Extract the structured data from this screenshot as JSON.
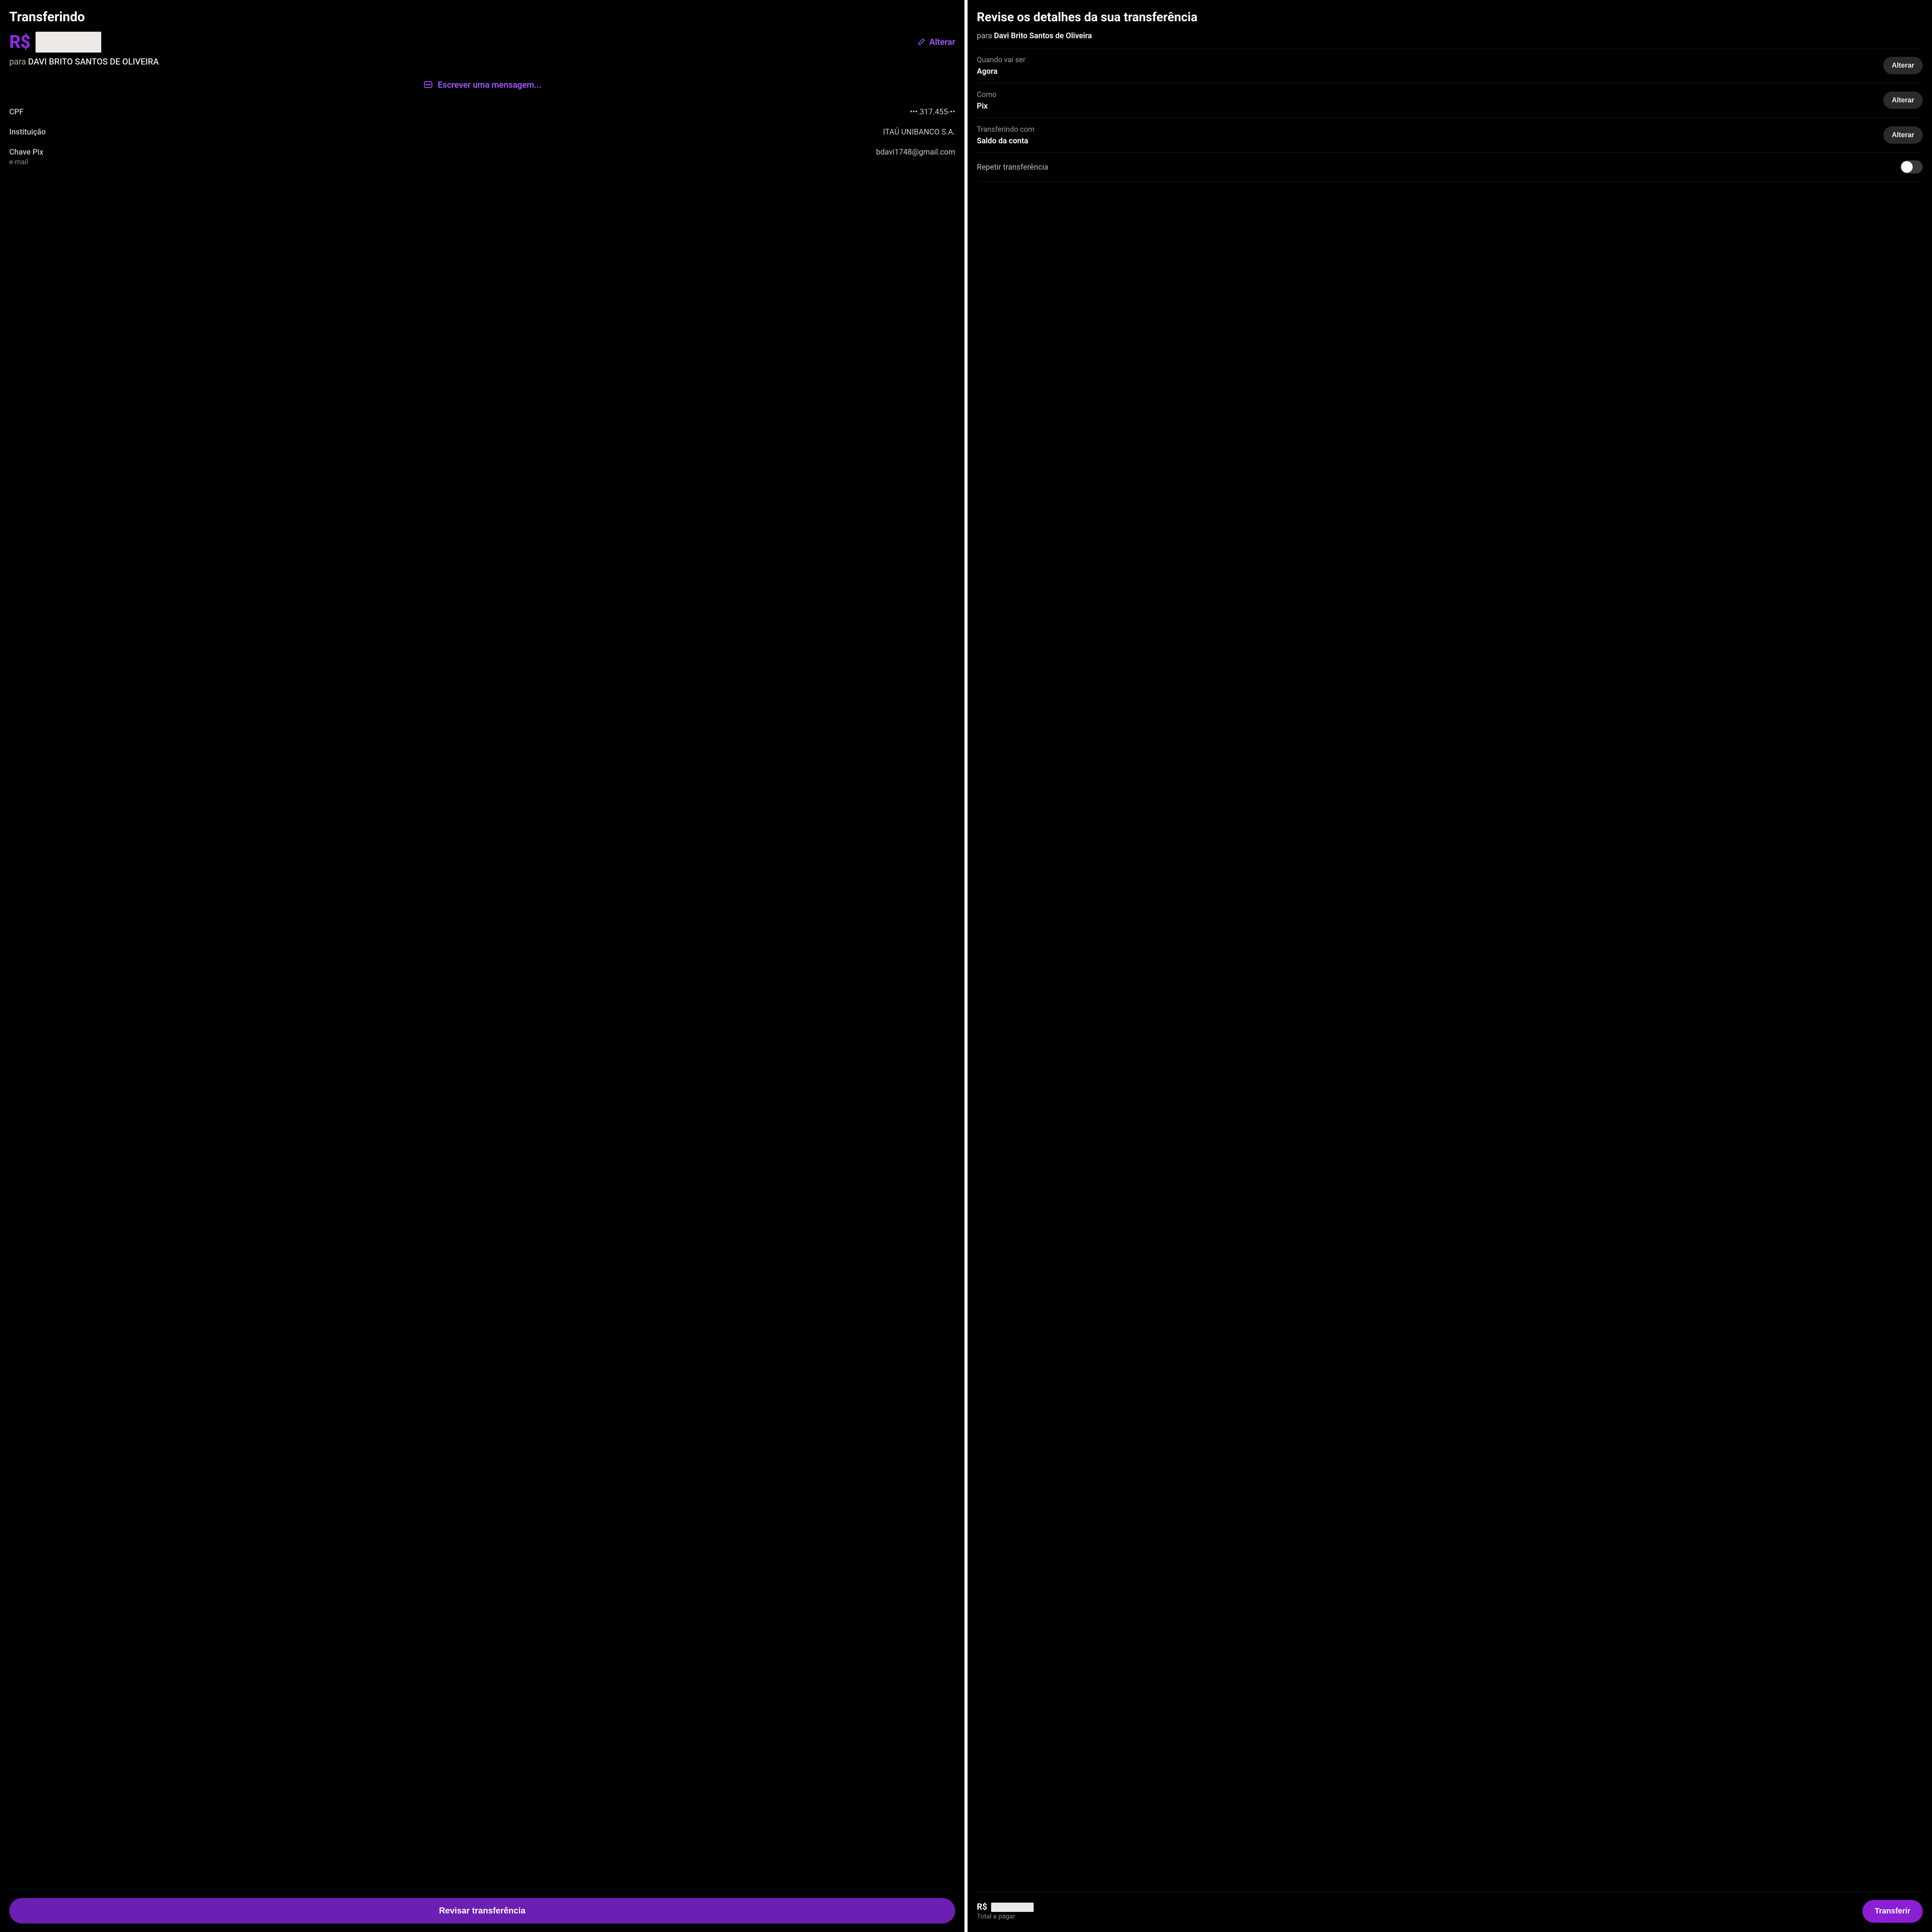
{
  "colors": {
    "accent": "#a259ff",
    "primary_button": "#6b1fb3",
    "transfer_button": "#8a1fd6"
  },
  "left": {
    "title": "Transferindo",
    "currency": "R$",
    "edit_label": "Alterar",
    "recipient_prefix": "para",
    "recipient_name": "DAVI BRITO SANTOS DE OLIVEIRA",
    "write_message": "Escrever uma mensagem...",
    "info": [
      {
        "label": "CPF",
        "sublabel": "",
        "value": "•••.317.455-••"
      },
      {
        "label": "Instituição",
        "sublabel": "",
        "value": "ITAÚ UNIBANCO S.A."
      },
      {
        "label": "Chave Pix",
        "sublabel": "e-mail",
        "value": "bdavi1748@gmail.com"
      }
    ],
    "primary_button": "Revisar transferência"
  },
  "right": {
    "title": "Revise os detalhes da sua transferência",
    "recipient_prefix": "para",
    "recipient_name": "Davi Brito Santos de Oliveira",
    "details": [
      {
        "label": "Quando vai ser",
        "value": "Agora",
        "action": "Alterar"
      },
      {
        "label": "Como",
        "value": "Pix",
        "action": "Alterar"
      },
      {
        "label": "Transferindo com",
        "value": "Saldo da conta",
        "action": "Alterar"
      }
    ],
    "repeat_label": "Repetir transferência",
    "repeat_on": false,
    "total_currency": "R$",
    "total_caption": "Total a pagar",
    "transfer_button": "Transferir"
  }
}
